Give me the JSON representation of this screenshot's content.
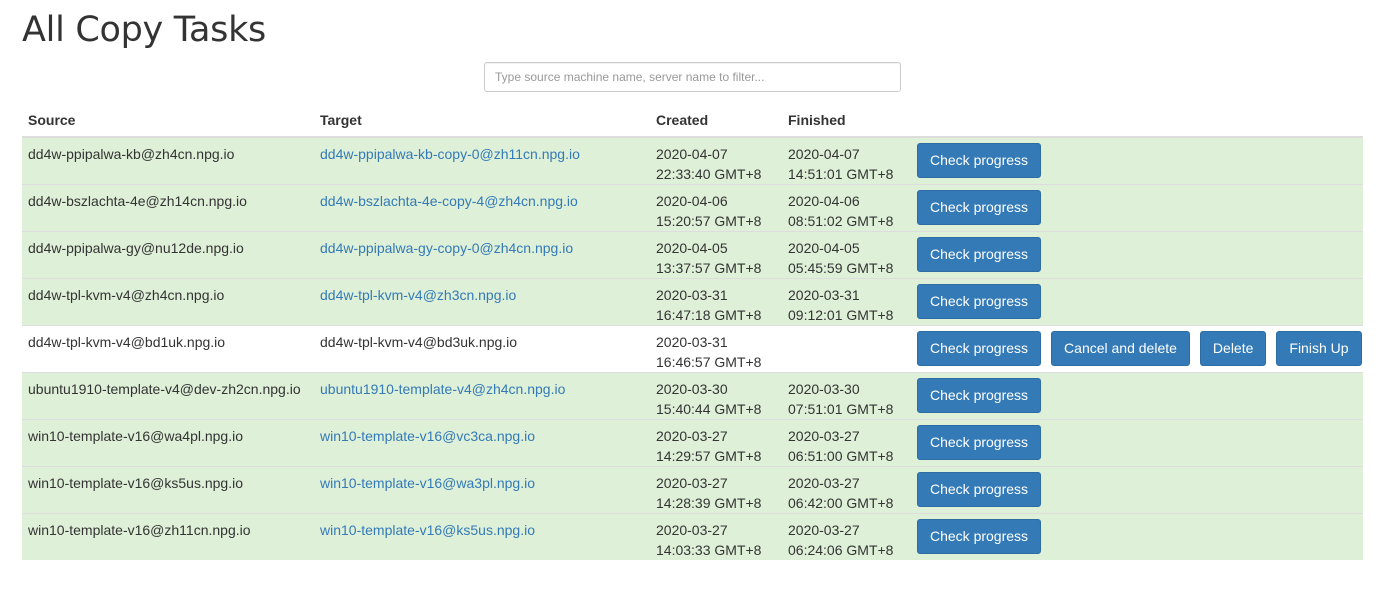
{
  "page": {
    "title": "All Copy Tasks",
    "filter_placeholder": "Type source machine name, server name to filter..."
  },
  "colors": {
    "done_row": "#dff0d8",
    "button": "#337ab7",
    "link": "#337ab7"
  },
  "columns": [
    "Source",
    "Target",
    "Created",
    "Finished",
    ""
  ],
  "rows": [
    {
      "status": "done",
      "source": "dd4w-ppipalwa-kb@zh4cn.npg.io",
      "target": "dd4w-ppipalwa-kb-copy-0@zh11cn.npg.io",
      "created_date": "2020-04-07",
      "created_time": "22:33:40 GMT+8",
      "finished_date": "2020-04-07",
      "finished_time": "14:51:01 GMT+8",
      "buttons": [
        "Check progress"
      ]
    },
    {
      "status": "done",
      "source": "dd4w-bszlachta-4e@zh14cn.npg.io",
      "target": "dd4w-bszlachta-4e-copy-4@zh4cn.npg.io",
      "created_date": "2020-04-06",
      "created_time": "15:20:57 GMT+8",
      "finished_date": "2020-04-06",
      "finished_time": "08:51:02 GMT+8",
      "buttons": [
        "Check progress"
      ]
    },
    {
      "status": "done",
      "source": "dd4w-ppipalwa-gy@nu12de.npg.io",
      "target": "dd4w-ppipalwa-gy-copy-0@zh4cn.npg.io",
      "created_date": "2020-04-05",
      "created_time": "13:37:57 GMT+8",
      "finished_date": "2020-04-05",
      "finished_time": "05:45:59 GMT+8",
      "buttons": [
        "Check progress"
      ]
    },
    {
      "status": "done",
      "source": "dd4w-tpl-kvm-v4@zh4cn.npg.io",
      "target": "dd4w-tpl-kvm-v4@zh3cn.npg.io",
      "created_date": "2020-03-31",
      "created_time": "16:47:18 GMT+8",
      "finished_date": "2020-03-31",
      "finished_time": "09:12:01 GMT+8",
      "buttons": [
        "Check progress"
      ]
    },
    {
      "status": "pending",
      "source": "dd4w-tpl-kvm-v4@bd1uk.npg.io",
      "target": "dd4w-tpl-kvm-v4@bd3uk.npg.io",
      "created_date": "2020-03-31",
      "created_time": "16:46:57 GMT+8",
      "finished_date": "",
      "finished_time": "",
      "buttons": [
        "Check progress",
        "Cancel and delete",
        "Delete",
        "Finish Up"
      ]
    },
    {
      "status": "done",
      "source": "ubuntu1910-template-v4@dev-zh2cn.npg.io",
      "target": "ubuntu1910-template-v4@zh4cn.npg.io",
      "created_date": "2020-03-30",
      "created_time": "15:40:44 GMT+8",
      "finished_date": "2020-03-30",
      "finished_time": "07:51:01 GMT+8",
      "buttons": [
        "Check progress"
      ]
    },
    {
      "status": "done",
      "source": "win10-template-v16@wa4pl.npg.io",
      "target": "win10-template-v16@vc3ca.npg.io",
      "created_date": "2020-03-27",
      "created_time": "14:29:57 GMT+8",
      "finished_date": "2020-03-27",
      "finished_time": "06:51:00 GMT+8",
      "buttons": [
        "Check progress"
      ]
    },
    {
      "status": "done",
      "source": "win10-template-v16@ks5us.npg.io",
      "target": "win10-template-v16@wa3pl.npg.io",
      "created_date": "2020-03-27",
      "created_time": "14:28:39 GMT+8",
      "finished_date": "2020-03-27",
      "finished_time": "06:42:00 GMT+8",
      "buttons": [
        "Check progress"
      ]
    },
    {
      "status": "done",
      "source": "win10-template-v16@zh11cn.npg.io",
      "target": "win10-template-v16@ks5us.npg.io",
      "created_date": "2020-03-27",
      "created_time": "14:03:33 GMT+8",
      "finished_date": "2020-03-27",
      "finished_time": "06:24:06 GMT+8",
      "buttons": [
        "Check progress"
      ]
    }
  ]
}
